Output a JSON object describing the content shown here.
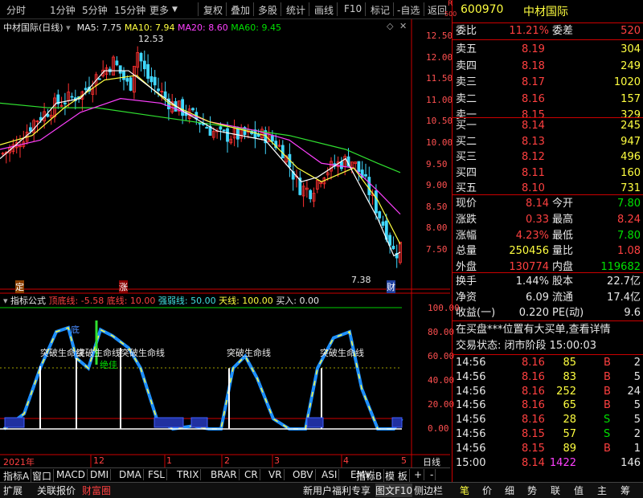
{
  "toolbar": {
    "items": [
      "分时",
      "1分钟",
      "5分钟",
      "15分钟",
      "更多",
      "复权",
      "叠加",
      "多股",
      "统计",
      "画线",
      "F10",
      "标记",
      "-自选",
      "返回"
    ]
  },
  "stock": {
    "badge_r": "R",
    "badge_num": "500",
    "code": "600970",
    "name": "中材国际"
  },
  "main": {
    "title": "中材国际(日线)",
    "ma5": "MA5: 7.75",
    "ma10": "MA10: 7.94",
    "ma20": "MA20: 8.60",
    "ma60": "MA60: 9.45",
    "high_mark": "12.53",
    "low_mark": "7.38",
    "tag_ding": "定",
    "tag_zhang": "涨",
    "tag_cai": "财",
    "y_ticks": [
      "12.50",
      "12.00",
      "11.50",
      "11.00",
      "10.50",
      "10.00",
      "9.50",
      "9.00",
      "8.50",
      "8.00",
      "7.50"
    ]
  },
  "indicator": {
    "title": "指标公式",
    "dinglie": "顶底线: -5.58",
    "diline": "底线: 10.00",
    "qiangruo": "强弱线: 50.00",
    "tianxian": "天线: 100.00",
    "mairu": "买入: 0.00",
    "y_ticks": [
      "100.00",
      "80.00",
      "60.00",
      "40.00",
      "20.00",
      "0.00"
    ],
    "labels": [
      "突破生命线",
      "突破生命线",
      "突破生命线",
      "突破生命线",
      "突破生命线"
    ],
    "blue_label": "底",
    "green_label": "绝佳"
  },
  "xaxis": {
    "labels": [
      "2021年",
      "12",
      "1",
      "2",
      "3",
      "4",
      "5"
    ],
    "right": "日线"
  },
  "tabs": [
    "指标A",
    "窗口",
    "MACD",
    "DMI",
    "DMA",
    "FSL",
    "TRIX",
    "BRAR",
    "CR",
    "VR",
    "OBV",
    "ASI",
    "EMV",
    "指标B",
    "模 板",
    "+",
    "-"
  ],
  "bottom": [
    "扩展",
    "关联报价",
    "财富圈",
    "新用户福利专享",
    "图文F10",
    "侧边栏",
    "笔",
    "价",
    "细",
    "势",
    "联",
    "值",
    "主",
    "筹"
  ],
  "quote": {
    "weibi_l": "委比",
    "weibi": "11.21%",
    "weicha_l": "委差",
    "weicha": "520",
    "sells": [
      {
        "l": "卖五",
        "p": "8.19",
        "v": "304"
      },
      {
        "l": "卖四",
        "p": "8.18",
        "v": "249"
      },
      {
        "l": "卖三",
        "p": "8.17",
        "v": "1020"
      },
      {
        "l": "卖二",
        "p": "8.16",
        "v": "157"
      },
      {
        "l": "卖一",
        "p": "8.15",
        "v": "329"
      }
    ],
    "buys": [
      {
        "l": "买一",
        "p": "8.14",
        "v": "245"
      },
      {
        "l": "买二",
        "p": "8.13",
        "v": "947"
      },
      {
        "l": "买三",
        "p": "8.12",
        "v": "496"
      },
      {
        "l": "买四",
        "p": "8.11",
        "v": "160"
      },
      {
        "l": "买五",
        "p": "8.10",
        "v": "731"
      }
    ],
    "stats": [
      {
        "l1": "现价",
        "v1": "8.14",
        "l2": "今开",
        "v2": "7.80"
      },
      {
        "l1": "涨跌",
        "v1": "0.33",
        "l2": "最高",
        "v2": "8.24"
      },
      {
        "l1": "涨幅",
        "v1": "4.23%",
        "l2": "最低",
        "v2": "7.80"
      },
      {
        "l1": "总量",
        "v1": "250456",
        "l2": "量比",
        "v2": "1.08"
      },
      {
        "l1": "外盘",
        "v1": "130774",
        "l2": "内盘",
        "v2": "119682"
      }
    ],
    "stats2": [
      {
        "l1": "换手",
        "v1": "1.44%",
        "l2": "股本",
        "v2": "22.7亿"
      },
      {
        "l1": "净资",
        "v1": "6.09",
        "l2": "流通",
        "v2": "17.4亿"
      },
      {
        "l1": "收益(一)",
        "v1": "0.220",
        "l2": "PE(动)",
        "v2": "9.6"
      }
    ],
    "notice": "在买盘***位置有大买单,查看详情",
    "status": "交易状态: 闭市阶段 15:00:03",
    "ticks": [
      {
        "t": "14:56",
        "p": "8.16",
        "v": "85",
        "s": "B",
        "n": "2"
      },
      {
        "t": "14:56",
        "p": "8.16",
        "v": "83",
        "s": "B",
        "n": "5"
      },
      {
        "t": "14:56",
        "p": "8.16",
        "v": "252",
        "s": "B",
        "n": "24"
      },
      {
        "t": "14:56",
        "p": "8.16",
        "v": "65",
        "s": "B",
        "n": "5"
      },
      {
        "t": "14:56",
        "p": "8.16",
        "v": "28",
        "s": "S",
        "n": "5"
      },
      {
        "t": "14:56",
        "p": "8.15",
        "v": "57",
        "s": "S",
        "n": "2"
      },
      {
        "t": "14:56",
        "p": "8.15",
        "v": "89",
        "s": "B",
        "n": "1"
      },
      {
        "t": "15:00",
        "p": "8.14",
        "v": "1422",
        "s": "",
        "n": "146"
      }
    ]
  }
}
